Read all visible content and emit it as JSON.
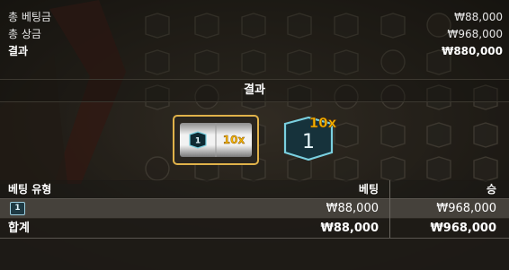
{
  "summary": {
    "total_bet_label": "총 베팅금",
    "total_bet_value": "₩88,000",
    "total_win_label": "총 상금",
    "total_win_value": "₩968,000",
    "result_label": "결과",
    "result_value": "₩880,000"
  },
  "result_section": {
    "title": "결과",
    "slot_symbol": "1",
    "slot_multiplier": "10x",
    "card_number": "1",
    "card_multiplier": "10x"
  },
  "table": {
    "headers": [
      "베팅 유형",
      "베팅",
      "승"
    ],
    "rows": [
      {
        "type_badge": "1",
        "bet": "₩88,000",
        "win": "₩968,000"
      }
    ],
    "total": {
      "label": "합계",
      "bet": "₩88,000",
      "win": "₩968,000"
    }
  },
  "colors": {
    "accent_gold": "#f5b400",
    "card_teal": "#7ad0e0",
    "row_highlight": "#45413b"
  }
}
